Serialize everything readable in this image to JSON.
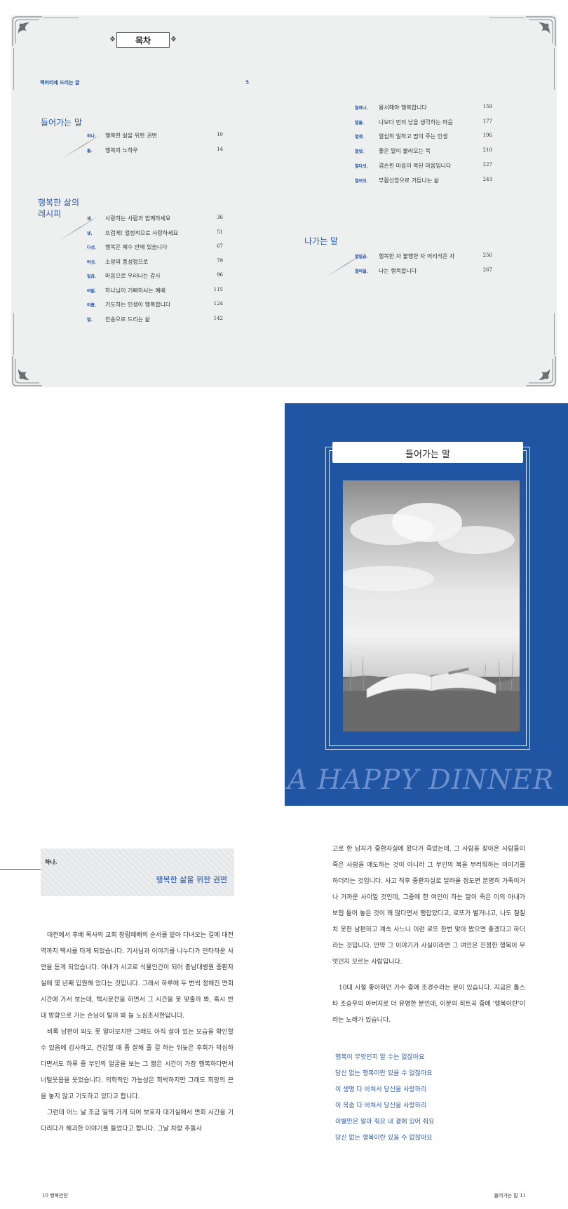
{
  "toc": {
    "badge": "목차",
    "preface": {
      "label": "책머리에 드리는 글",
      "page": "5"
    },
    "section1": {
      "title": "들어가는 말",
      "entries": [
        {
          "num": "하나.",
          "title": "행복한 삶을 위한 권면",
          "page": "10"
        },
        {
          "num": "둘.",
          "title": "행복의 노하우",
          "page": "14"
        }
      ]
    },
    "section2": {
      "title_line1": "행복한 삶의",
      "title_line2": "레시피",
      "entries": [
        {
          "num": "셋.",
          "title": "사랑하는 사람과 함께하세요",
          "page": "36"
        },
        {
          "num": "넷.",
          "title": "뜨겁게! 열정적으로 사랑하세요",
          "page": "51"
        },
        {
          "num": "다섯.",
          "title": "행복은 예수 안에 있습니다",
          "page": "67"
        },
        {
          "num": "여섯.",
          "title": "소망의 풍성함으로",
          "page": "79"
        },
        {
          "num": "일곱.",
          "title": "마음으로 우러나는 감사",
          "page": "96"
        },
        {
          "num": "여덟.",
          "title": "하나님이 기뻐하시는 예배",
          "page": "115"
        },
        {
          "num": "아홉.",
          "title": "기도하는 인생이 행복합니다",
          "page": "124"
        },
        {
          "num": "열.",
          "title": "찬송으로 드리는 삶",
          "page": "142"
        }
      ]
    },
    "section2b": {
      "entries": [
        {
          "num": "열하나.",
          "title": "용서해야 행복합니다",
          "page": "159"
        },
        {
          "num": "열둘.",
          "title": "나보다 먼저 남을 생각하는 마음",
          "page": "177"
        },
        {
          "num": "열셋.",
          "title": "열심히 일하고 땀이 주는 인생",
          "page": "196"
        },
        {
          "num": "열넷.",
          "title": "좋은 말이 불러오는 복",
          "page": "210"
        },
        {
          "num": "열다섯.",
          "title": "겸손한 마음이 복된 마음입니다",
          "page": "227"
        },
        {
          "num": "열여섯.",
          "title": "부활신앙으로 거듭나는 삶",
          "page": "243"
        }
      ]
    },
    "section3": {
      "title": "나가는 말",
      "entries": [
        {
          "num": "열일곱.",
          "title": "행복한 자 불행한 자 어리석은 자",
          "page": "256"
        },
        {
          "num": "열여덟.",
          "title": "나는 행복합니다",
          "page": "267"
        }
      ]
    }
  },
  "opener": {
    "title": "들어가는 말",
    "banner": "A HAPPY DINNER",
    "bg_color": "#1f55a3"
  },
  "chapter": {
    "num": "하나.",
    "title": "행복한 삶을 위한 권면",
    "left_paragraphs": [
      "대전에서 후배 목사의 교회 창립예배의 순서를 맡아 다녀오는 길에 대전역까지 택시를 타게 되었습니다. 기사님과 이야기를 나누다가 안타까운 사연을 듣게 되었습니다. 아내가 사고로 식물인간이 되어 충남대병원 중환자실에 몇 년째 입원해 있다는 것입니다. 그래서 하루에 두 번씩 정해진 면회 시간에 가서 보는데, 택시운전을 하면서 그 시간을 못 맞출까 봐, 혹시 반대 방향으로 가는 손님이 탈까 봐 늘 노심초사한답니다.",
      "비록 남편이 와도 못 알아보지만 그래도 아직 살아 있는 모습을 확인할 수 있음에 감사하고, 건강할 때 좀 잘해 줄 걸 하는 뒤늦은 후회가 막심하다면서도 하루 중 부인의 얼굴을 보는 그 짧은 시간이 가장 행복하다면서 너털웃음을 웃었습니다. 의학적인 가능성은 희박하지만 그래도 희망의 끈을 놓지 않고 기도하고 있다고 합니다.",
      "그런데 어느 날 조금 일찍 가게 되어 보호자 대기실에서 면회 시간을 기다리다가 해괴한 이야기를 들었다고 합니다. 그날 차량 추돌사"
    ],
    "right_paragraphs": [
      "고로 한 남자가 중환자실에 왔다가 죽었는데, 그 사람을 찾아온 사람들이 죽은 사람을 애도하는 것이 아니라 그 부인의 복을 부러워하는 이야기를 하더라는 것입니다. 사고 직후 중환자실로 달려올 정도면 분명히 가족이거나 가까운 사이일 것인데, 그중에 한 여인이 하는 말이 죽은 이의 아내가 보험 들어 놓은 것이 꽤 많다면서 땡잡았다고, 로또가 별거냐고, 나도 칠칠치 못한 남편하고 계속 사느니 이런 로또 한번 맞아 봤으면 좋겠다고 하더라는 것입니다. 만약 그 이야기가 사실이라면 그 여인은 진정한 행복이 무엇인지 모르는 사람입니다.",
      "10대 시절 좋아하던 가수 중에 조경수라는 분이 있습니다. 지금은 톱스타 조승우의 아버지로 더 유명한 분인데, 이분의 히트곡 중에 '행복이란'이라는 노래가 있습니다."
    ],
    "lyrics": [
      "행복이 무엇인지 알 수는 없잖아요",
      "당신 없는 행복이란 있을 수 없잖아요",
      "이 생명 다 바쳐서 당신을 사랑하리",
      "이 목숨 다 바쳐서 당신을 사랑하리",
      "이별만은 말아 줘요 내 곁에 있어 줘요",
      "당신 없는 행복이란 있을 수 없잖아요"
    ]
  },
  "folio": {
    "left": "10   행복만찬",
    "right": "들어가는 말   11"
  }
}
